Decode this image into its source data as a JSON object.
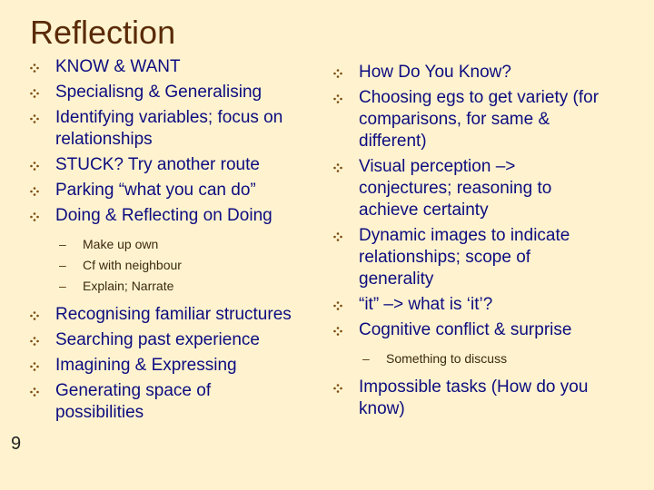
{
  "slide": {
    "title": "Reflection",
    "page_number": "9",
    "colors": {
      "background": "#fff3cf",
      "title": "#5a2a06",
      "bullet_text": "#0c0c80",
      "sub_text": "#3a2a10",
      "bullet_icon": "#7a4a10"
    }
  },
  "left_column": {
    "items_a": [
      {
        "text": "KNOW & WANT"
      },
      {
        "text": "Specialisng & Generalising"
      },
      {
        "text": "Identifying variables; focus on relationships"
      },
      {
        "text": "STUCK? Try another route"
      },
      {
        "text": "Parking “what you can do”"
      },
      {
        "text": "Doing & Reflecting on Doing"
      }
    ],
    "sub_items": [
      {
        "dash": "–",
        "text": "Make up own"
      },
      {
        "dash": "–",
        "text": "Cf with neighbour"
      },
      {
        "dash": "–",
        "text": "Explain; Narrate"
      }
    ],
    "items_b": [
      {
        "text": "Recognising familiar structures"
      },
      {
        "text": "Searching past experience"
      },
      {
        "text": "Imagining & Expressing"
      },
      {
        "text": "Generating space of possibilities"
      }
    ]
  },
  "right_column": {
    "items_a": [
      {
        "text": "How Do You Know?"
      },
      {
        "text": "Choosing egs to get variety (for comparisons, for same & different)"
      },
      {
        "text": "Visual perception –> conjectures; reasoning to achieve certainty"
      },
      {
        "text": "Dynamic images to indicate relationships; scope of generality"
      },
      {
        "text": "“it” –> what is ‘it’?"
      },
      {
        "text": "Cognitive conflict & surprise"
      }
    ],
    "sub_items": [
      {
        "dash": "–",
        "text": "Something to discuss"
      }
    ],
    "items_b": [
      {
        "text": "Impossible tasks (How do you know)"
      }
    ]
  }
}
